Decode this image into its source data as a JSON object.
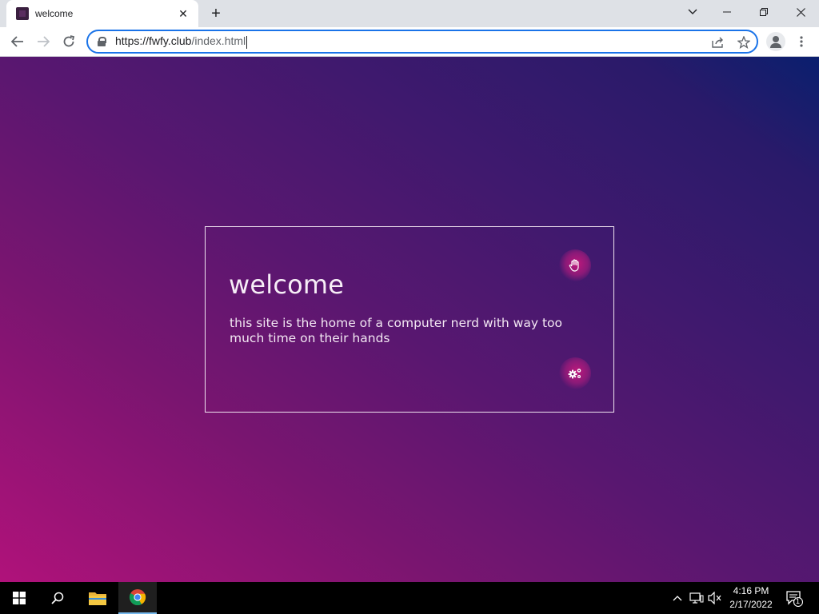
{
  "browser": {
    "tab_title": "welcome",
    "tab_close": "✕",
    "new_tab": "+",
    "url_host": "https://fwfy.club",
    "url_path": "/index.html",
    "window_controls": {
      "dropdown": "⌄",
      "minimize": "—",
      "restore": "❐",
      "close": "✕"
    }
  },
  "page": {
    "title": "welcome",
    "description": "this site is the home of a computer nerd with way too much time on their hands",
    "icons": [
      "hand-icon",
      "gears-icon"
    ],
    "colors": {
      "gradient_start": "#b0127a",
      "gradient_mid": "#591770",
      "gradient_end": "#0a1f6e",
      "accent": "#c0187c"
    }
  },
  "taskbar": {
    "time": "4:16 PM",
    "date": "2/17/2022",
    "notification_count": "1"
  }
}
